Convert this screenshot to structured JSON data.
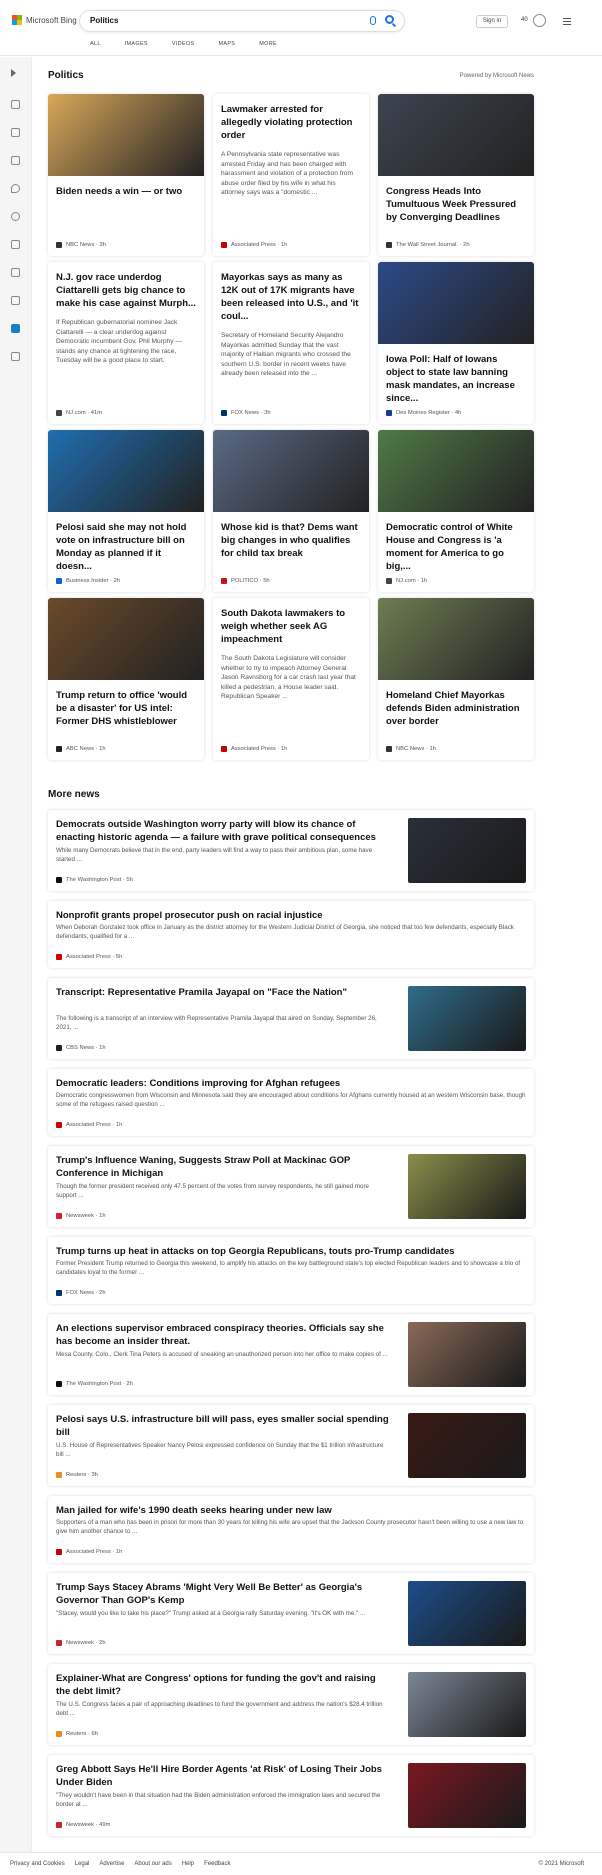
{
  "header": {
    "brand": "Microsoft Bing",
    "query": "Politics",
    "signin": "Sign in",
    "points": "40",
    "tabs": [
      "ALL",
      "IMAGES",
      "VIDEOS",
      "MAPS",
      "MORE"
    ]
  },
  "section": {
    "title": "Politics",
    "powered": "Powered by Microsoft News"
  },
  "cards": [
    {
      "title": "Biden needs a win — or two",
      "desc": "",
      "source": "NBC News · 3h",
      "img": "#d9a85a",
      "src_color": "#333"
    },
    {
      "title": "Lawmaker arrested for allegedly violating protection order",
      "desc": "A Pennsylvania state representative was arrested Friday and has been charged with harassment and violation of a protection from abuse order filed by his wife in what his attorney says was a \"domestic ...",
      "source": "Associated Press · 1h",
      "img": "",
      "src_color": "#c00"
    },
    {
      "title": "Congress Heads Into Tumultuous Week Pressured by Converging Deadlines",
      "desc": "",
      "source": "The Wall Street Journal. · 2h",
      "img": "#3d4550",
      "src_color": "#333"
    },
    {
      "title": "N.J. gov race underdog Ciattarelli gets big chance to make his case against Murph...",
      "desc": "If Republican gubernatorial nominee Jack Ciattarelli — a clear underdog against Democratic incumbent Gov. Phil Murphy — stands any chance at tightening the race, Tuesday will be a good place to start.",
      "source": "NJ.com · 41m",
      "img": "",
      "src_color": "#444"
    },
    {
      "title": "Mayorkas says as many as 12K out of 17K migrants have been released into U.S., and 'it coul...",
      "desc": "Secretary of Homeland Security Alejandro Mayorkas admitted Sunday that the vast majority of Haitian migrants who crossed the southern U.S. border in recent weeks have already been released into the ...",
      "source": "FOX News · 3h",
      "img": "",
      "src_color": "#003366"
    },
    {
      "title": "Iowa Poll: Half of Iowans object to state law banning mask mandates, an increase since...",
      "desc": "",
      "source": "Des Moines Register · 4h",
      "img": "#2c4a88",
      "src_color": "#1a3d8f"
    },
    {
      "title": "Pelosi said she may not hold vote on infrastructure bill on Monday as planned if it doesn...",
      "desc": "",
      "source": "Business Insider · 2h",
      "img": "#1e6fb0",
      "src_color": "#1a5fd0"
    },
    {
      "title": "Whose kid is that? Dems want big changes in who qualifies for child tax break",
      "desc": "",
      "source": "POLITICO · 5h",
      "img": "#5a6a85",
      "src_color": "#c0161a"
    },
    {
      "title": "Democratic control of White House and Congress is 'a moment for America to go big,...",
      "desc": "",
      "source": "NJ.com · 1h",
      "img": "#4f7a46",
      "src_color": "#444"
    },
    {
      "title": "Trump return to office 'would be a disaster' for US intel: Former DHS whistleblower",
      "desc": "",
      "source": "ABC News · 1h",
      "img": "#6a4a2a",
      "src_color": "#222"
    },
    {
      "title": "South Dakota lawmakers to weigh whether seek AG impeachment",
      "desc": "The South Dakota Legislature will consider whether to try to impeach Attorney General Jason Ravnsborg for a car crash last year that killed a pedestrian, a House leader said. Republican Speaker ...",
      "source": "Associated Press · 1h",
      "img": "",
      "src_color": "#c00"
    },
    {
      "title": "Homeland Chief Mayorkas defends Biden administration over border",
      "desc": "",
      "source": "NBC News · 1h",
      "img": "#6e7d52",
      "src_color": "#333"
    }
  ],
  "more_news": {
    "title": "More news",
    "items": [
      {
        "title": "Democrats outside Washington worry party will blow its chance of enacting historic agenda — a failure with grave political consequences",
        "desc": "While many Democrats believe that in the end, party leaders will find a way to pass their ambitious plan, some have started ...",
        "source": "The Washington Post · 5h",
        "thumb": "#2a2f3a",
        "src_color": "#111"
      },
      {
        "title": "Nonprofit grants propel prosecutor push on racial injustice",
        "desc": "When Deborah Gonzalez took office in January as the district attorney for the Western Judicial District of Georgia, she noticed that too few defendants, especially Black defendants, qualified for a ...",
        "source": "Associated Press · 5h",
        "thumb": "",
        "src_color": "#c00"
      },
      {
        "title": "Transcript: Representative Pramila Jayapal on \"Face the Nation\"",
        "desc": "The following is a transcript of an interview with Representative Pramila Jayapal that aired on Sunday, September 26, 2021, ...",
        "source": "CBS News · 1h",
        "thumb": "#2f6d8a",
        "src_color": "#222"
      },
      {
        "title": "Democratic leaders: Conditions improving for Afghan refugees",
        "desc": "Democratic congresswomen from Wisconsin and Minnesota said they are encouraged about conditions for Afghans currently housed at an western Wisconsin base, though some of the refugees raised question ...",
        "source": "Associated Press · 1h",
        "thumb": "",
        "src_color": "#c00"
      },
      {
        "title": "Trump's Influence Waning, Suggests Straw Poll at Mackinac GOP Conference in Michigan",
        "desc": "Though the former president received only 47.5 percent of the votes from survey respondents, he still gained more support ...",
        "source": "Newsweek · 1h",
        "thumb": "#8a8f4a",
        "src_color": "#d4202a"
      },
      {
        "title": "Trump turns up heat in attacks on top Georgia Republicans, touts pro-Trump candidates",
        "desc": "Former President Trump returned to Georgia this weekend, to amplify his attacks on the key battleground state's top elected Republican leaders and to showcase a trio of candidates loyal to the former ...",
        "source": "FOX News · 2h",
        "thumb": "",
        "src_color": "#003366"
      },
      {
        "title": "An elections supervisor embraced conspiracy theories. Officials say she has become an insider threat.",
        "desc": "Mesa County, Colo., Clerk Tina Peters is accused of sneaking an unauthorized person into her office to make copies of ...",
        "source": "The Washington Post · 2h",
        "thumb": "#8a6a58",
        "src_color": "#111"
      },
      {
        "title": "Pelosi says U.S. infrastructure bill will pass, eyes smaller social spending bill",
        "desc": "U.S. House of Representatives Speaker Nancy Pelosi expressed confidence on Sunday that the $1 trillion infrastructure bill ...",
        "source": "Reuters · 3h",
        "thumb": "#3a1a14",
        "src_color": "#f08a24"
      },
      {
        "title": "Man jailed for wife's 1990 death seeks hearing under new law",
        "desc": "Supporters of a man who has been in prison for more than 30 years for killing his wife are upset that the Jackson County prosecutor hasn't been willing to use a new law to give him another chance to ...",
        "source": "Associated Press · 1h",
        "thumb": "",
        "src_color": "#c00"
      },
      {
        "title": "Trump Says Stacey Abrams 'Might Very Well Be Better' as Georgia's Governor Than GOP's Kemp",
        "desc": "\"Stacey, would you like to take his place?\" Trump asked at a Georgia rally Saturday evening. \"It's OK with me.\" ...",
        "source": "Newsweek · 2h",
        "thumb": "#1c4e8a",
        "src_color": "#d4202a"
      },
      {
        "title": "Explainer-What are Congress' options for funding the gov't and raising the debt limit?",
        "desc": "The U.S. Congress faces a pair of approaching deadlines to fund the government and address the nation's $28.4 trillion debt ...",
        "source": "Reuters · 6h",
        "thumb": "#7c8796",
        "src_color": "#f08a24"
      },
      {
        "title": "Greg Abbott Says He'll Hire Border Agents 'at Risk' of Losing Their Jobs Under Biden",
        "desc": "\"They wouldn't have been in that situation had the Biden administration enforced the immigration laws and secured the border at ...",
        "source": "Newsweek · 49m",
        "thumb": "#7a1820",
        "src_color": "#d4202a"
      }
    ]
  },
  "footer": {
    "links": [
      "Privacy and Cookies",
      "Legal",
      "Advertise",
      "About our ads",
      "Help",
      "Feedback"
    ],
    "copyright": "© 2021 Microsoft"
  }
}
